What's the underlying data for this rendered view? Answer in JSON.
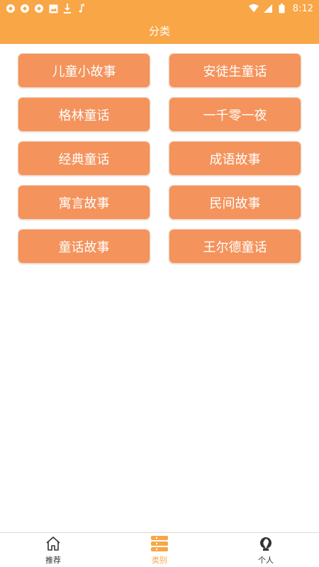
{
  "status_bar": {
    "time": "8:12",
    "left_icons": [
      "notification-icon",
      "notification-icon",
      "notification-icon",
      "image-icon",
      "download-icon",
      "music-icon"
    ],
    "right_icons": [
      "wifi-icon",
      "signal-icon",
      "battery-icon"
    ]
  },
  "header": {
    "title": "分类"
  },
  "categories": [
    {
      "label": "儿童小故事"
    },
    {
      "label": "安徒生童话"
    },
    {
      "label": "格林童话"
    },
    {
      "label": "一千零一夜"
    },
    {
      "label": "经典童话"
    },
    {
      "label": "成语故事"
    },
    {
      "label": "寓言故事"
    },
    {
      "label": "民间故事"
    },
    {
      "label": "童话故事"
    },
    {
      "label": "王尔德童话"
    }
  ],
  "bottom_nav": {
    "items": [
      {
        "label": "推荐",
        "icon": "home-icon",
        "active": false
      },
      {
        "label": "类别",
        "icon": "category-icon",
        "active": true
      },
      {
        "label": "个人",
        "icon": "profile-icon",
        "active": false
      }
    ]
  },
  "colors": {
    "primary": "#f9a647",
    "button": "#f4935c",
    "active_label": "#f9a647",
    "inactive_label": "#333333"
  }
}
